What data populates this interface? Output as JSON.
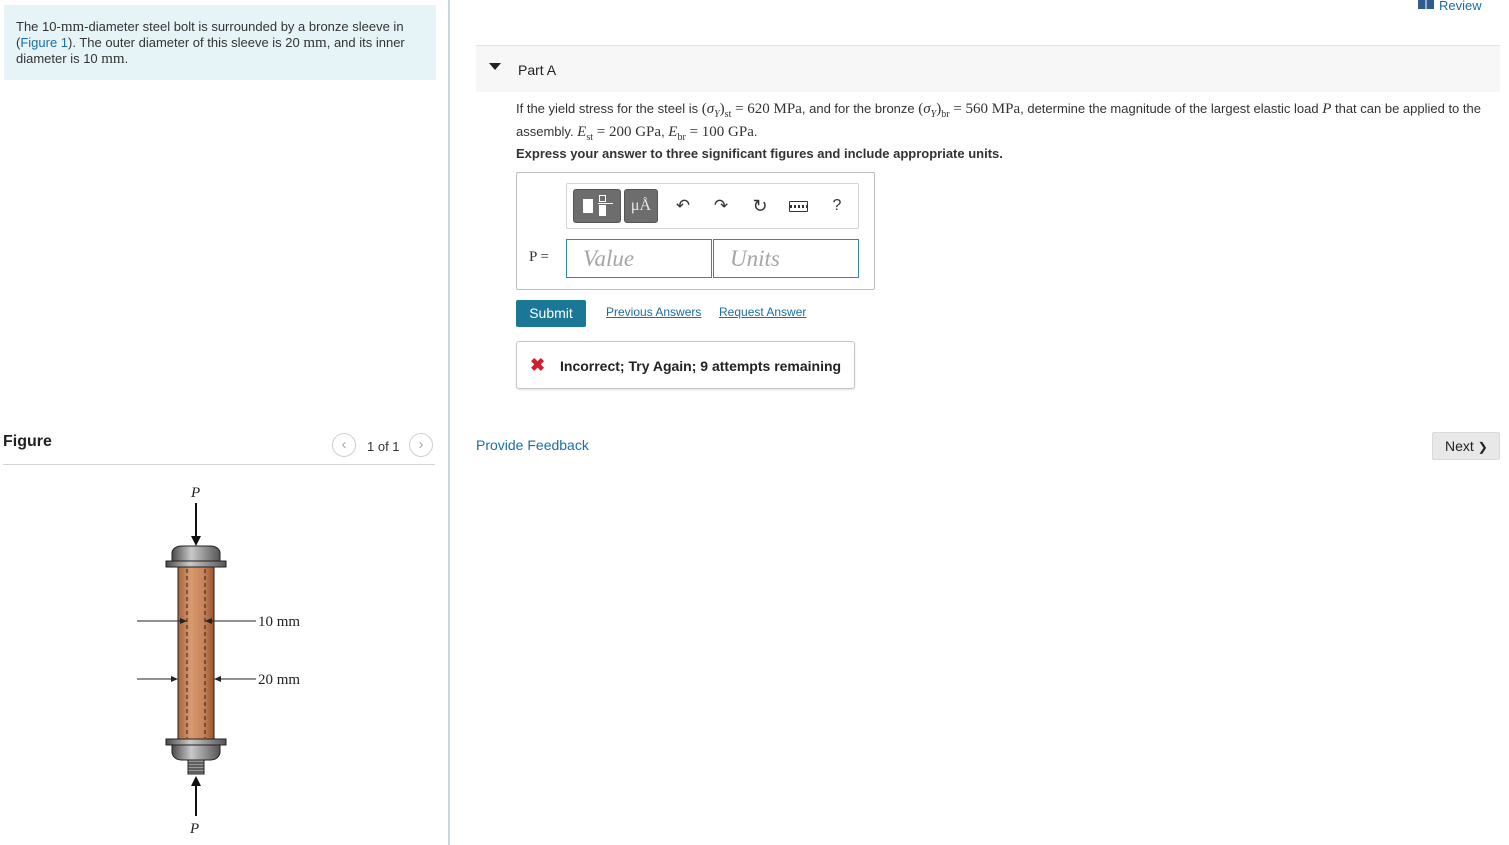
{
  "problem": {
    "text_part1": "The 10-",
    "unit_mm1": "mm",
    "text_part2": "-diameter steel bolt is surrounded by a bronze sleeve in (",
    "figure_link": "Figure 1",
    "text_part3": "). The outer diameter of this sleeve is 20 ",
    "unit_mm2": "mm",
    "text_part4": ", and its inner diameter is 10 ",
    "unit_mm3": "mm",
    "text_part5": "."
  },
  "figure": {
    "title": "Figure",
    "counter": "1 of 1",
    "prev_icon": "chevron-left-icon",
    "next_icon": "chevron-right-icon",
    "load_label_top": "P",
    "load_label_bottom": "P",
    "dim_inner": "10 mm",
    "dim_outer": "20 mm",
    "colors": {
      "bronze": "#c8845a",
      "steel": "#6b6b6b"
    }
  },
  "header": {
    "review_label": "Review",
    "review_icon": "book-icon"
  },
  "part": {
    "title": "Part A",
    "caret_icon": "caret-down-icon"
  },
  "question": {
    "t1": "If the yield stress for the steel is ",
    "sigma": "σ",
    "Y": "Y",
    "st": "st",
    "eq1": " = 620 MPa",
    "t2": ", and for the bronze ",
    "br": "br",
    "eq2": " = 560 MPa",
    "t3": ", determine the magnitude of the largest elastic load ",
    "P": "P",
    "t4": " that can be applied to the assembly. ",
    "E": "E",
    "eq3": " = 200 GPa",
    "sep": ", ",
    "eq4": " = 100 GPa",
    "end": "."
  },
  "instructions": "Express your answer to three significant figures and include appropriate units.",
  "answer": {
    "label": "P =",
    "value_placeholder": "Value",
    "units_placeholder": "Units",
    "value": "",
    "units": "",
    "toolbar": {
      "templates_icon": "templates-icon",
      "symbols_label": "μÅ",
      "undo_glyph": "↶",
      "redo_glyph": "↷",
      "reset_glyph": "↻",
      "keyboard_icon": "keyboard-icon",
      "help_label": "?"
    }
  },
  "actions": {
    "submit": "Submit",
    "previous_answers": "Previous Answers",
    "request_answer": "Request Answer"
  },
  "feedback": {
    "icon_glyph": "✖",
    "message": "Incorrect; Try Again; 9 attempts remaining",
    "status_color": "#d11d2e"
  },
  "footer": {
    "provide_feedback": "Provide Feedback",
    "next_label": "Next",
    "next_glyph": "❯"
  },
  "theme": {
    "accent": "#1a7896",
    "link": "#1a6ea8",
    "problem_bg": "#e6f4f8"
  }
}
